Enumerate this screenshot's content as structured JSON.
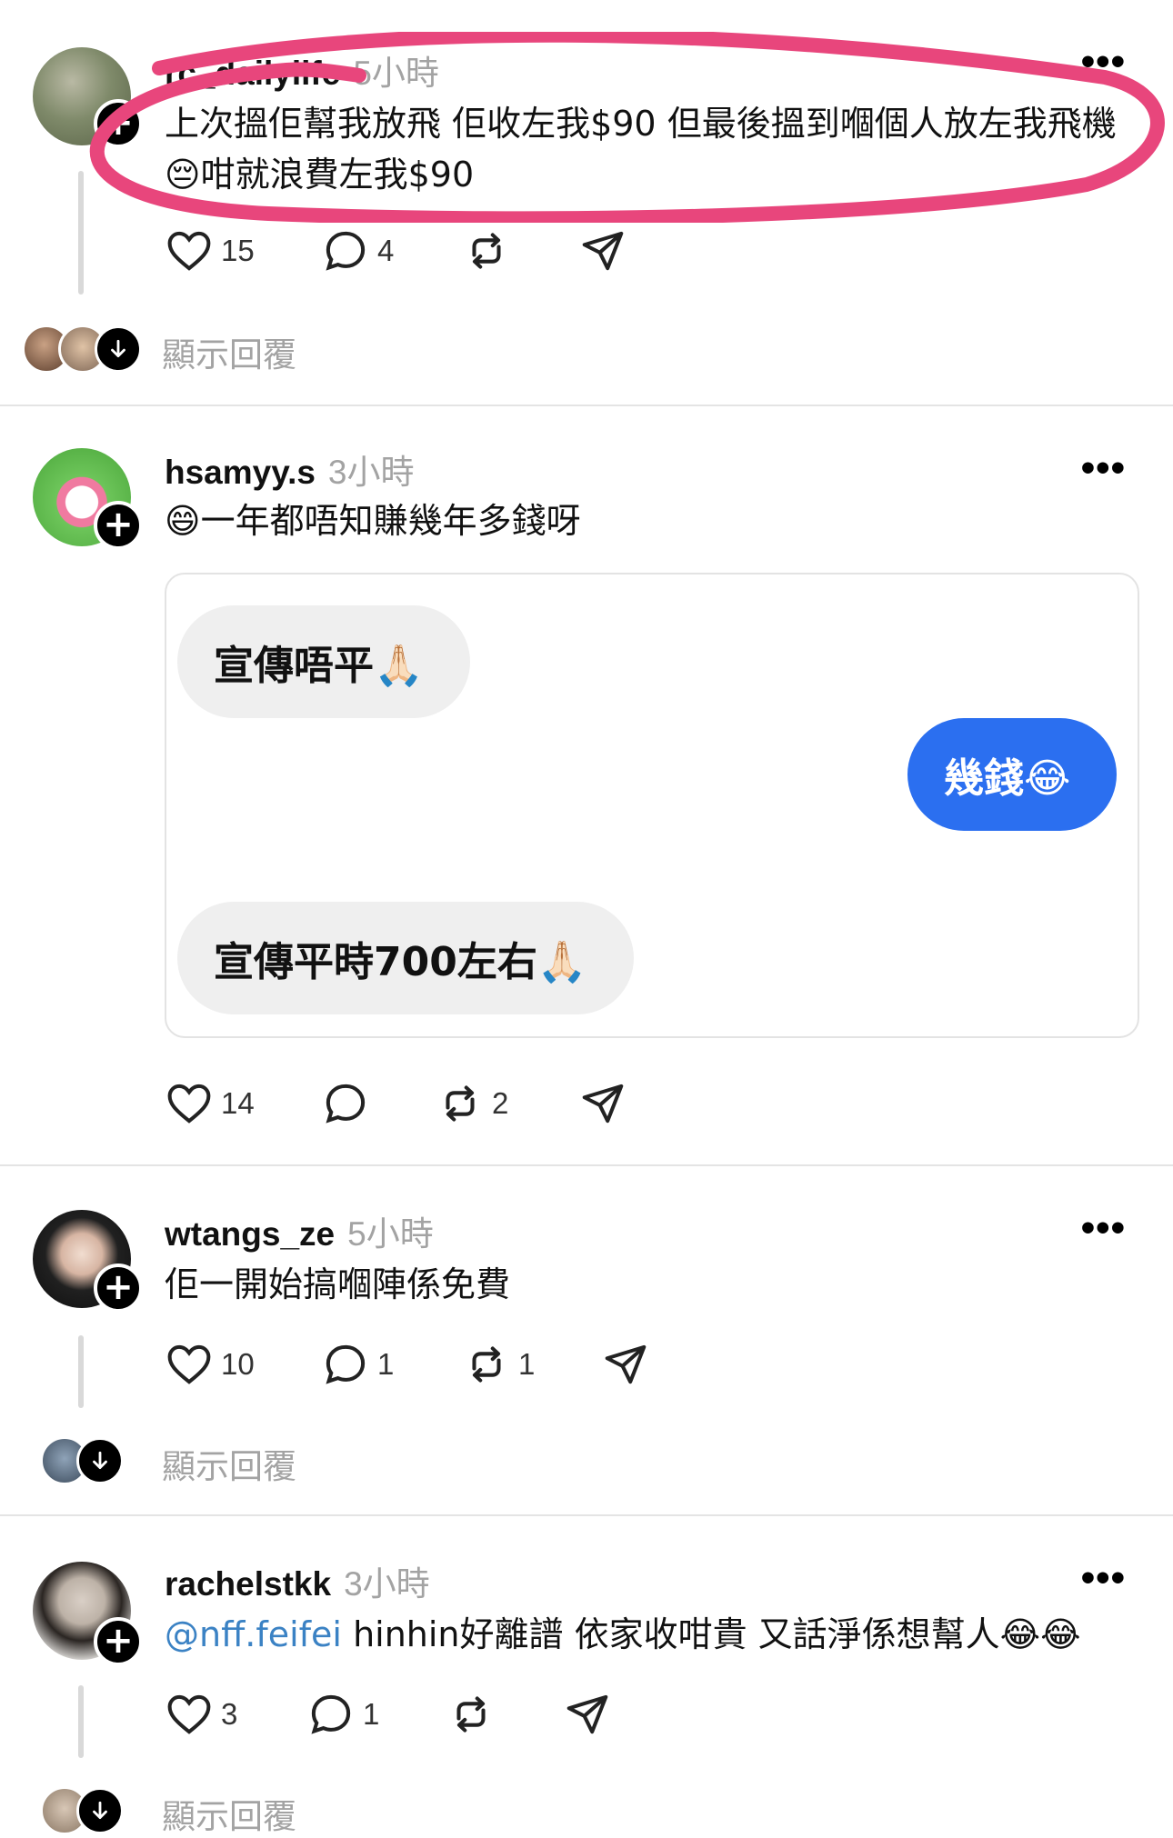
{
  "posts": [
    {
      "username": "rc_dailylife",
      "time": "5小時",
      "text": "上次搵佢幫我放飛 佢收左我$90 但最後搵到嗰個人放左我飛機😔咁就浪費左我$90",
      "likes": "15",
      "comments": "4",
      "reposts": "",
      "show_replies": "顯示回覆"
    },
    {
      "username": "hsamyy.s",
      "time": "3小時",
      "text": "😄一年都唔知賺幾年多錢呀",
      "chat": {
        "msg1": "宣傳唔平🙏🏻",
        "msg2": "幾錢😂",
        "msg3": "宣傳平時700左右🙏🏻"
      },
      "likes": "14",
      "comments": "",
      "reposts": "2"
    },
    {
      "username": "wtangs_ze",
      "time": "5小時",
      "text": "佢一開始搞嗰陣係免費",
      "likes": "10",
      "comments": "1",
      "reposts": "1",
      "show_replies": "顯示回覆"
    },
    {
      "username": "rachelstkk",
      "time": "3小時",
      "mention": "@nff.feifei",
      "text": " hinhin好離譜 依家收咁貴 又話淨係想幫人😂😂",
      "likes": "3",
      "comments": "1",
      "reposts": "",
      "show_replies": "顯示回覆"
    }
  ],
  "icons": {
    "like": "heart-icon",
    "comment": "comment-bubble-icon",
    "repost": "repost-icon",
    "share": "send-icon",
    "more": "more-dots-icon",
    "follow": "plus-icon",
    "expand": "arrow-down-icon"
  },
  "colors": {
    "annotation": "#e8467c",
    "chat_blue": "#2b6ff0",
    "mention": "#3b82c4"
  }
}
